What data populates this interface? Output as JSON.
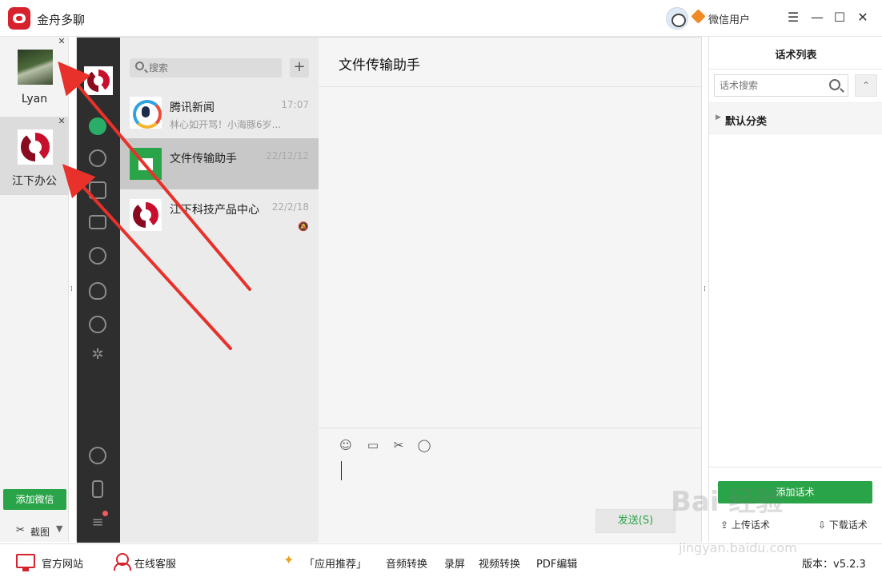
{
  "titlebar": {
    "app_title": "金舟多聊",
    "user_name": "微信用户",
    "menu_glyph": "☰",
    "minimize_glyph": "—",
    "maximize_glyph": "☐",
    "close_glyph": "✕"
  },
  "accounts": [
    {
      "name": "Lyan",
      "close": "✕"
    },
    {
      "name": "江下办公",
      "close": "✕"
    }
  ],
  "left_bar": {
    "add_wechat_label": "添加微信",
    "screenshot_label": "截图"
  },
  "session_list": {
    "search_placeholder": "搜索",
    "plus_label": "+",
    "sessions": [
      {
        "name": "腾讯新闻",
        "time": "17:07",
        "preview": "林心如开骂！小海豚6岁..."
      },
      {
        "name": "文件传输助手",
        "time": "22/12/12",
        "preview": ""
      },
      {
        "name": "江下科技产品中心",
        "time": "22/2/18",
        "preview": ""
      }
    ]
  },
  "chat": {
    "title": "文件传输助手",
    "send_label": "发送(S)"
  },
  "script_panel": {
    "title": "话术列表",
    "search_placeholder": "话术搜索",
    "category": "默认分类",
    "add_label": "添加话术",
    "upload_label": "上传话术",
    "download_label": "下载话术"
  },
  "bottombar": {
    "official_site": "官方网站",
    "online_service": "在线客服",
    "app_recommend": "「应用推荐」",
    "audio_convert": "音频转换",
    "record_screen": "录屏",
    "video_convert": "视频转换",
    "pdf_edit": "PDF编辑",
    "version": "版本：v5.2.3"
  },
  "icons": {
    "app_logo": "red-chat-bubble-icon",
    "nav": [
      "chat-icon",
      "contacts-icon",
      "box-icon",
      "folder-icon",
      "aperture-icon",
      "butterfly-icon",
      "atom-icon",
      "sparkle-icon",
      "mini-program-icon",
      "phone-icon",
      "menu-icon"
    ],
    "tools": [
      "emoji-icon",
      "folder-icon",
      "scissors-icon",
      "chat-bubble-icon"
    ]
  },
  "colors": {
    "accent_green": "#2aa448",
    "brand_red": "#d6222c",
    "nav_dark": "#2e2e2e",
    "annotation_red": "#e8312a"
  },
  "watermark": {
    "text": "Bai 经验",
    "url": "jingyan.baidu.com"
  }
}
